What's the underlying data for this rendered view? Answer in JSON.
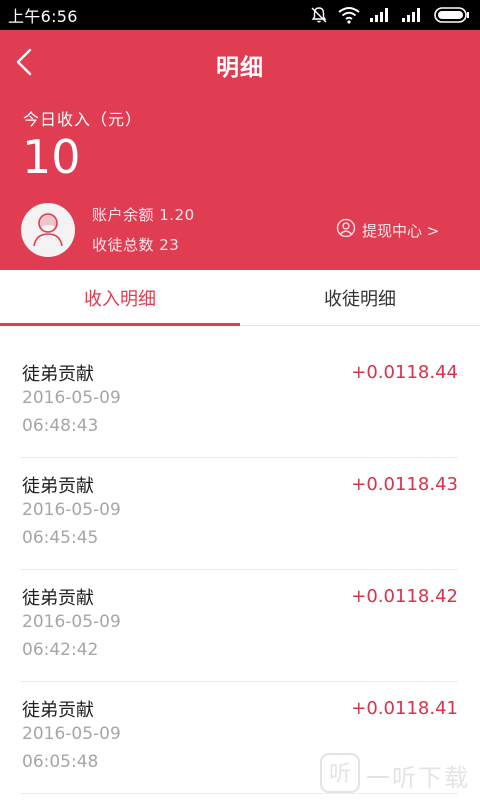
{
  "status_bar": {
    "time": "上午6:56"
  },
  "nav": {
    "title": "明细"
  },
  "summary": {
    "today_label": "今日收入（元）",
    "today_value": "10",
    "balance_text": "账户余额 1.20",
    "followers_text": "收徒总数 23",
    "withdraw_label": "提现中心 >"
  },
  "tabs": [
    {
      "label": "收入明细",
      "active": true
    },
    {
      "label": "收徒明细",
      "active": false
    }
  ],
  "records": [
    {
      "title": "徒弟贡献",
      "date": "2016-05-09",
      "time": "06:48:43",
      "amount": "+0.0118.44"
    },
    {
      "title": "徒弟贡献",
      "date": "2016-05-09",
      "time": "06:45:45",
      "amount": "+0.0118.43"
    },
    {
      "title": "徒弟贡献",
      "date": "2016-05-09",
      "time": "06:42:42",
      "amount": "+0.0118.42"
    },
    {
      "title": "徒弟贡献",
      "date": "2016-05-09",
      "time": "06:05:48",
      "amount": "+0.0118.41"
    }
  ],
  "watermark": {
    "text": "一听下载"
  },
  "colors": {
    "accent": "#e03c52",
    "amount": "#d83349",
    "muted": "#a6a6a6"
  },
  "icons": {
    "back": "chevron-left-icon",
    "user": "user-circle-icon",
    "avatar": "avatar-icon",
    "mute": "bell-off-icon",
    "wifi": "wifi-icon",
    "signal": "signal-icon",
    "battery": "battery-icon"
  }
}
